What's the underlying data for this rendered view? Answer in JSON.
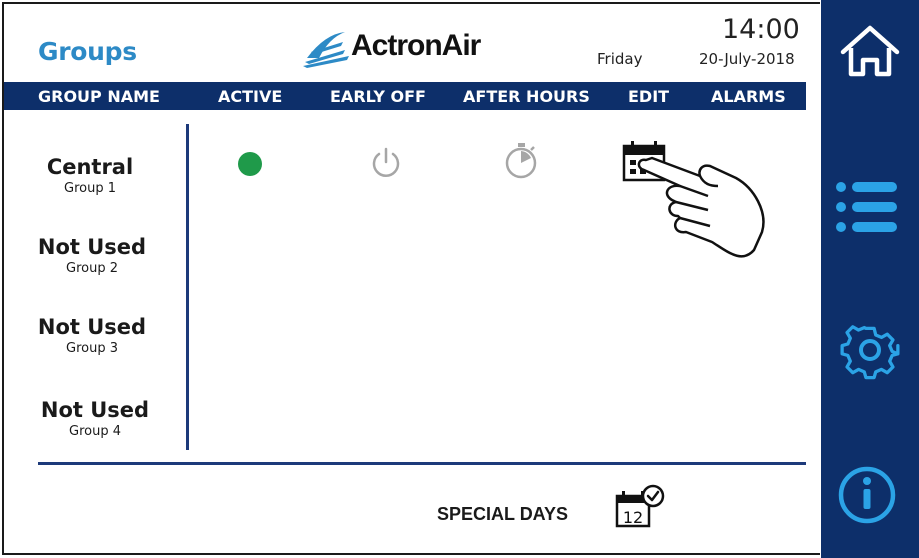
{
  "header": {
    "title": "Groups",
    "brand": "ActronAir",
    "day": "Friday",
    "time": "14:00",
    "date": "20-July-2018"
  },
  "columns": [
    "GROUP NAME",
    "ACTIVE",
    "EARLY OFF",
    "AFTER HOURS",
    "EDIT",
    "ALARMS"
  ],
  "groups": [
    {
      "name": "Central",
      "sub": "Group 1"
    },
    {
      "name": "Not Used",
      "sub": "Group 2"
    },
    {
      "name": "Not Used",
      "sub": "Group 3"
    },
    {
      "name": "Not Used",
      "sub": "Group 4"
    }
  ],
  "row1": {
    "active_icon": "status-dot",
    "early_off_icon": "power-icon",
    "after_hours_icon": "stopwatch-icon",
    "edit_icon": "calendar-icon"
  },
  "footer": {
    "special_days_label": "SPECIAL DAYS",
    "special_days_icon_number": "12"
  },
  "sidebar": {
    "items": [
      {
        "icon": "home-icon"
      },
      {
        "icon": "menu-icon"
      },
      {
        "icon": "gear-icon"
      },
      {
        "icon": "info-icon"
      }
    ]
  },
  "colors": {
    "navy": "#0d2f6a",
    "title_blue": "#2d8ac6",
    "sidebar_icon_blue": "#2ba3e6",
    "active_green": "#1f9a4a",
    "inactive_grey": "#a6a6a6"
  }
}
